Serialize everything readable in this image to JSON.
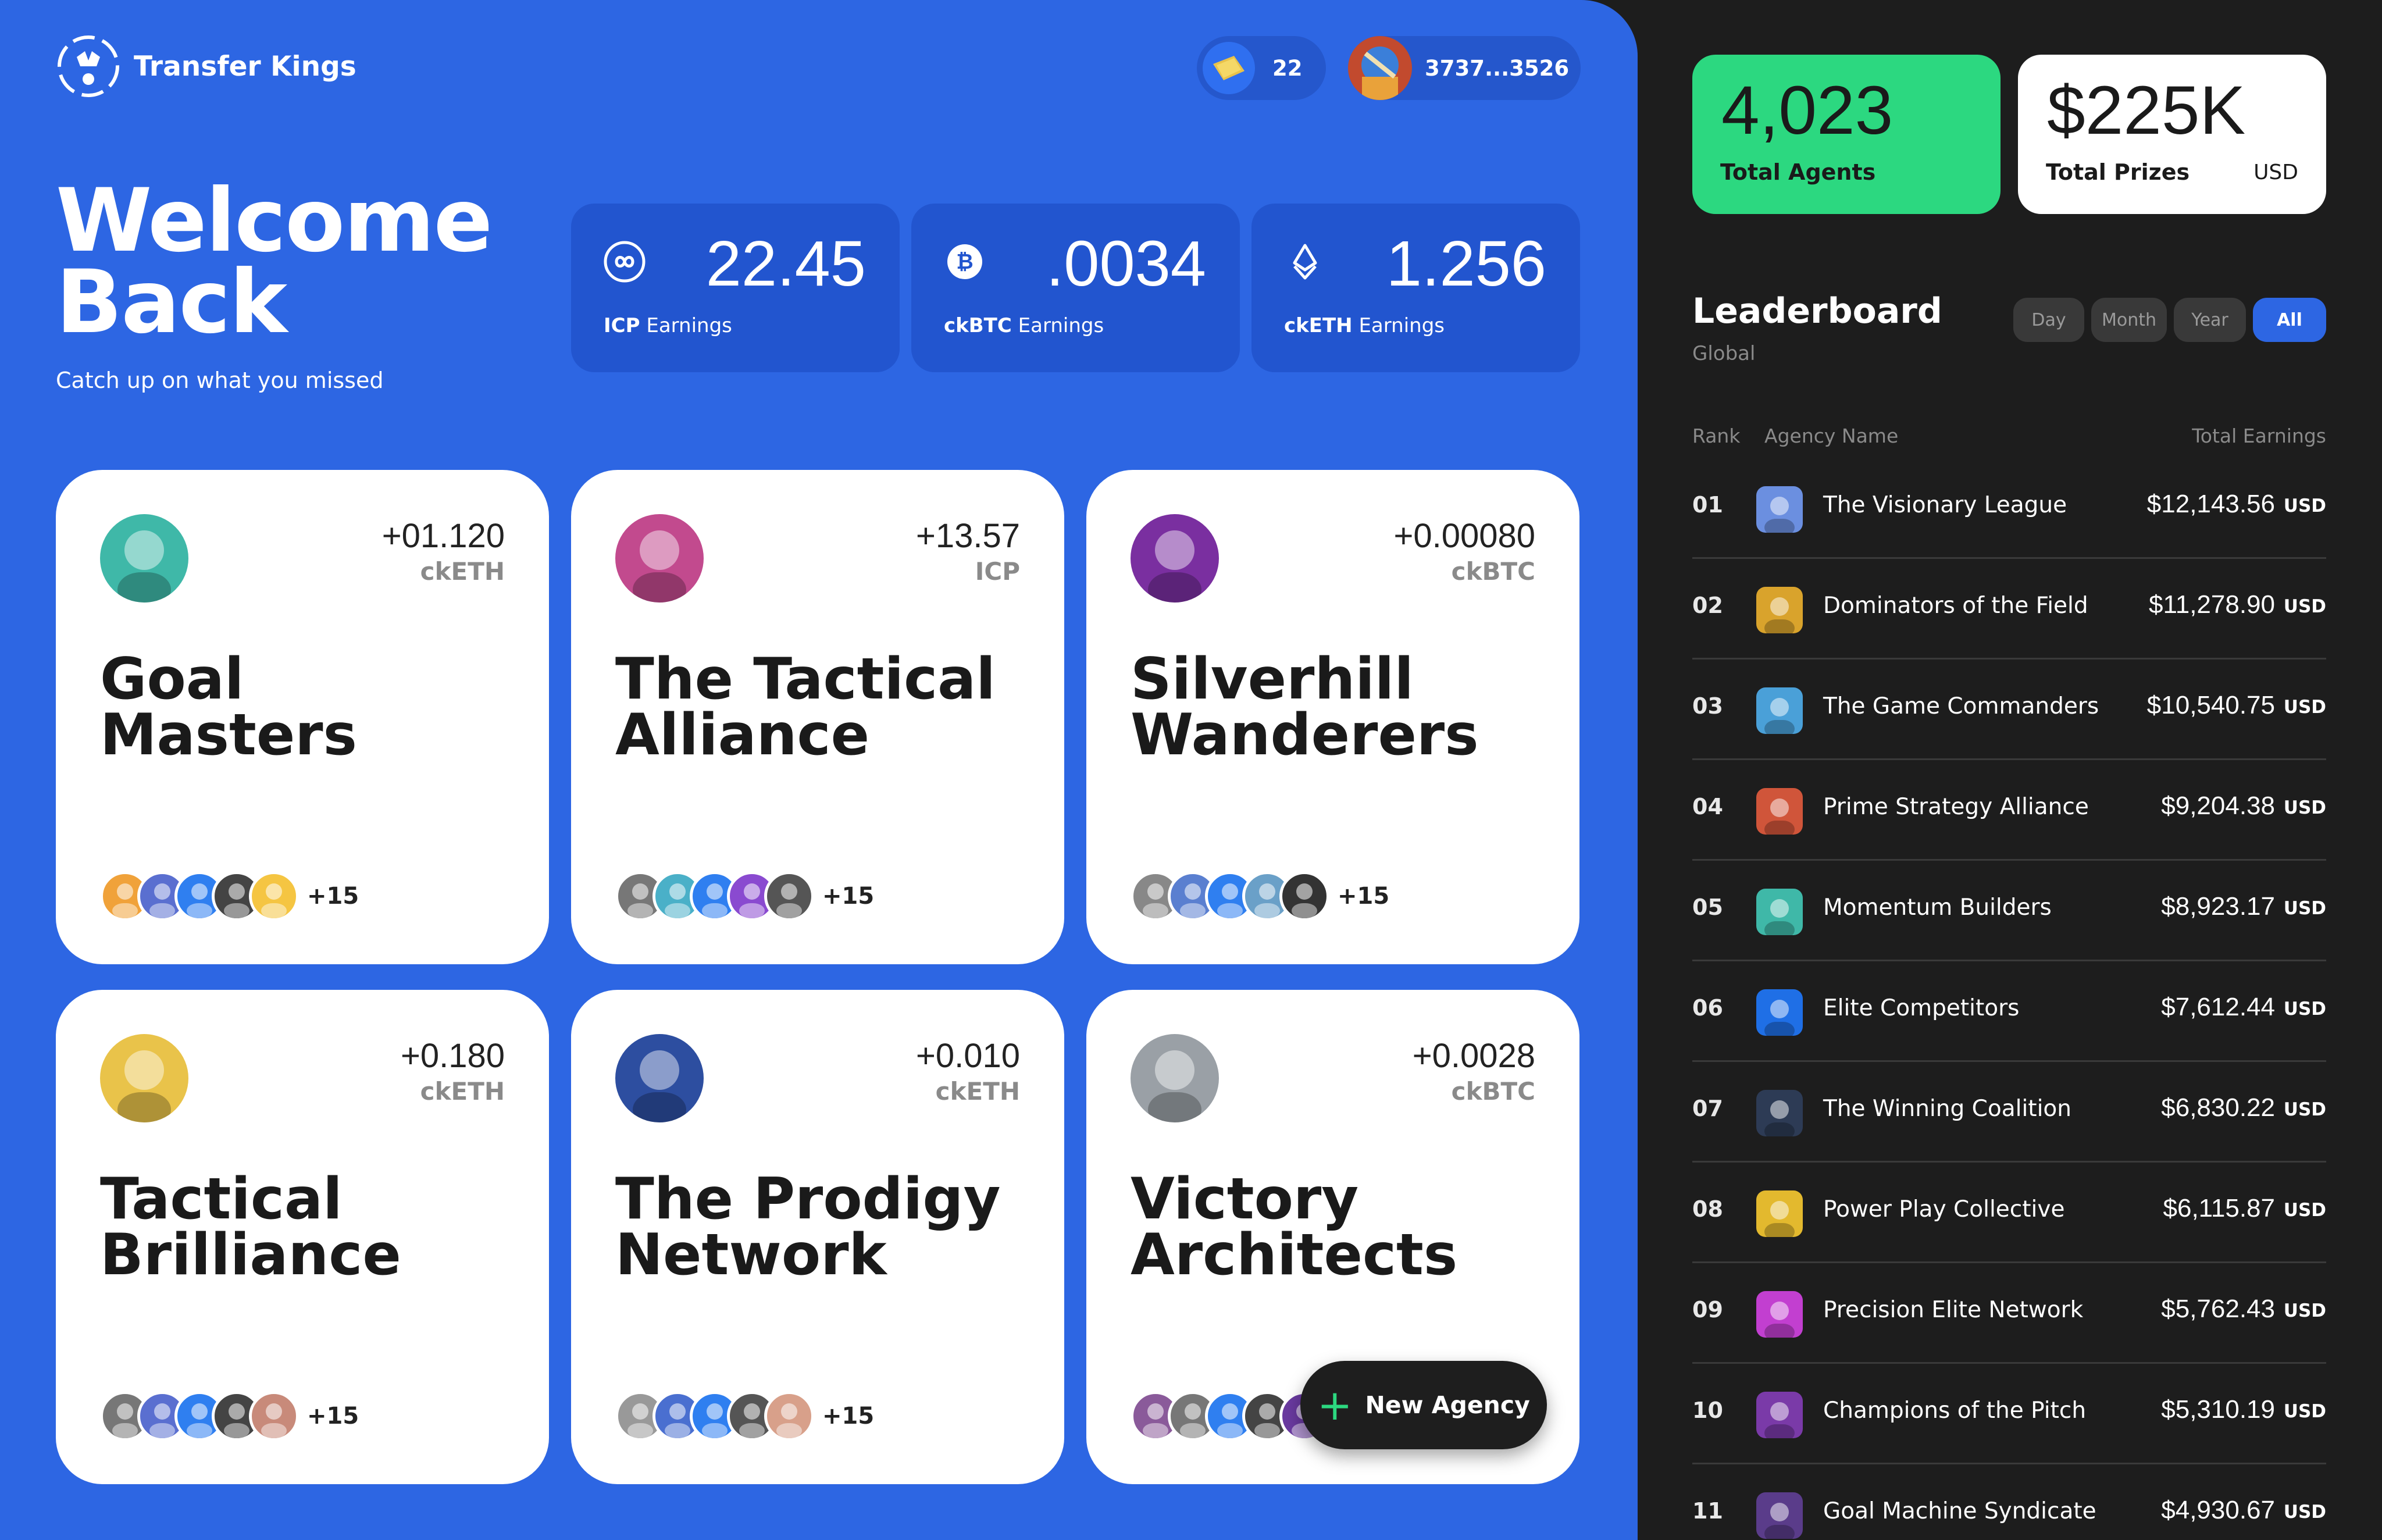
{
  "app": {
    "name": "Transfer Kings"
  },
  "header": {
    "coins": "22",
    "wallet": "3737...3526"
  },
  "welcome": {
    "title_line1": "Welcome",
    "title_line2": "Back",
    "subtitle": "Catch up on what you missed"
  },
  "earnings": [
    {
      "value": "22.45",
      "currency": "ICP",
      "label": "Earnings",
      "icon": "infinity-icon"
    },
    {
      "value": ".0034",
      "currency": "ckBTC",
      "label": "Earnings",
      "icon": "bitcoin-icon"
    },
    {
      "value": "1.256",
      "currency": "ckETH",
      "label": "Earnings",
      "icon": "ethereum-icon"
    }
  ],
  "agencies": [
    {
      "line1": "Goal",
      "line2": "Masters",
      "amount": "+01.120",
      "currency": "ckETH",
      "more": "+15",
      "color": "#3fb8a8"
    },
    {
      "line1": "The Tactical",
      "line2": "Alliance",
      "amount": "+13.57",
      "currency": "ICP",
      "more": "+15",
      "color": "#c24a8e"
    },
    {
      "line1": "Silverhill",
      "line2": "Wanderers",
      "amount": "+0.00080",
      "currency": "ckBTC",
      "more": "+15",
      "color": "#7a2fa0"
    },
    {
      "line1": "Tactical",
      "line2": "Brilliance",
      "amount": "+0.180",
      "currency": "ckETH",
      "more": "+15",
      "color": "#e9c34a"
    },
    {
      "line1": "The Prodigy",
      "line2": "Network",
      "amount": "+0.010",
      "currency": "ckETH",
      "more": "+15",
      "color": "#2d4ea0"
    },
    {
      "line1": "Victory",
      "line2": "Architects",
      "amount": "+0.0028",
      "currency": "ckBTC",
      "more": "",
      "color": "#9aa0a6"
    }
  ],
  "new_agency": {
    "label": "New Agency"
  },
  "stats": {
    "agents": {
      "value": "4,023",
      "label": "Total Agents"
    },
    "prizes": {
      "value": "$225K",
      "label": "Total Prizes",
      "unit": "USD"
    }
  },
  "leaderboard": {
    "title": "Leaderboard",
    "subtitle": "Global",
    "tabs": [
      "Day",
      "Month",
      "Year",
      "All"
    ],
    "active_tab": "All",
    "columns": {
      "rank": "Rank",
      "name": "Agency Name",
      "earnings": "Total Earnings"
    },
    "rows": [
      {
        "rank": "01",
        "name": "The Visionary League",
        "earnings": "$12,143.56",
        "unit": "USD",
        "color": "#6b8fe0"
      },
      {
        "rank": "02",
        "name": "Dominators of the Field",
        "earnings": "$11,278.90",
        "unit": "USD",
        "color": "#d9a32c"
      },
      {
        "rank": "03",
        "name": "The Game Commanders",
        "earnings": "$10,540.75",
        "unit": "USD",
        "color": "#4aa0d8"
      },
      {
        "rank": "04",
        "name": "Prime Strategy Alliance",
        "earnings": "$9,204.38",
        "unit": "USD",
        "color": "#d0553a"
      },
      {
        "rank": "05",
        "name": "Momentum Builders",
        "earnings": "$8,923.17",
        "unit": "USD",
        "color": "#3fb8a8"
      },
      {
        "rank": "06",
        "name": "Elite Competitors",
        "earnings": "$7,612.44",
        "unit": "USD",
        "color": "#1f6fe6"
      },
      {
        "rank": "07",
        "name": "The Winning Coalition",
        "earnings": "$6,830.22",
        "unit": "USD",
        "color": "#2d3b55"
      },
      {
        "rank": "08",
        "name": "Power Play Collective",
        "earnings": "$6,115.87",
        "unit": "USD",
        "color": "#e3b92e"
      },
      {
        "rank": "09",
        "name": "Precision Elite Network",
        "earnings": "$5,762.43",
        "unit": "USD",
        "color": "#c23fd0"
      },
      {
        "rank": "10",
        "name": "Champions of the Pitch",
        "earnings": "$5,310.19",
        "unit": "USD",
        "color": "#7a3aa8"
      },
      {
        "rank": "11",
        "name": "Goal Machine Syndicate",
        "earnings": "$4,930.67",
        "unit": "USD",
        "color": "#5a3c8a"
      }
    ]
  }
}
